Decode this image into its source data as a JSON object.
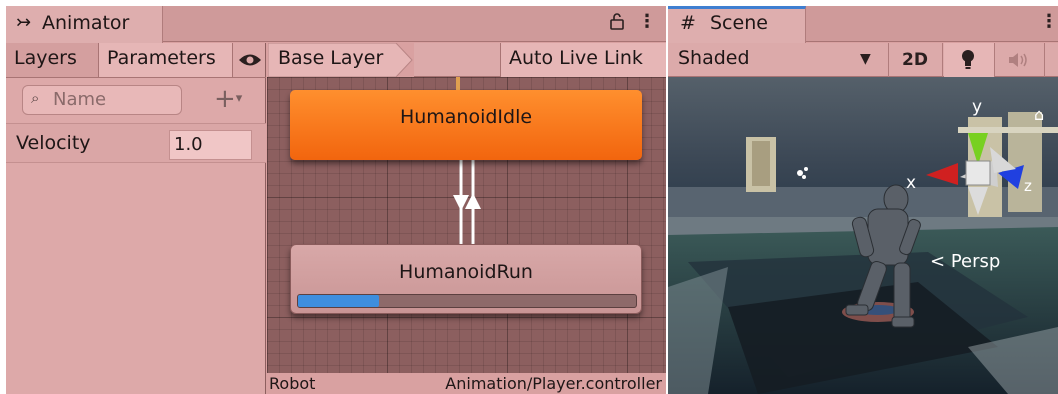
{
  "animator": {
    "tab_title": "Animator",
    "tab_icon": "animator-icon",
    "tabs": {
      "layers": "Layers",
      "parameters": "Parameters"
    },
    "search_placeholder": "Name",
    "parameter": {
      "name": "Velocity",
      "value": "1.0"
    },
    "breadcrumb": "Base Layer",
    "auto_live_link": "Auto Live Link",
    "states": {
      "idle": {
        "name": "HumanoidIdle",
        "color": "#f2650e"
      },
      "run": {
        "name": "HumanoidRun",
        "progress": 0.24
      }
    },
    "status": {
      "object": "Robot",
      "controller": "Animation/Player.controller"
    }
  },
  "scene": {
    "tab_title": "Scene",
    "shading_mode": "Shaded",
    "mode_2d": "2D",
    "gizmo": {
      "y": "y",
      "x": "x",
      "z": "z",
      "projection": "Persp"
    }
  },
  "colors": {
    "accent_blue": "#3e8ede",
    "idle_state": "#f2650e",
    "tab_active_border": "#3f7fd1"
  }
}
